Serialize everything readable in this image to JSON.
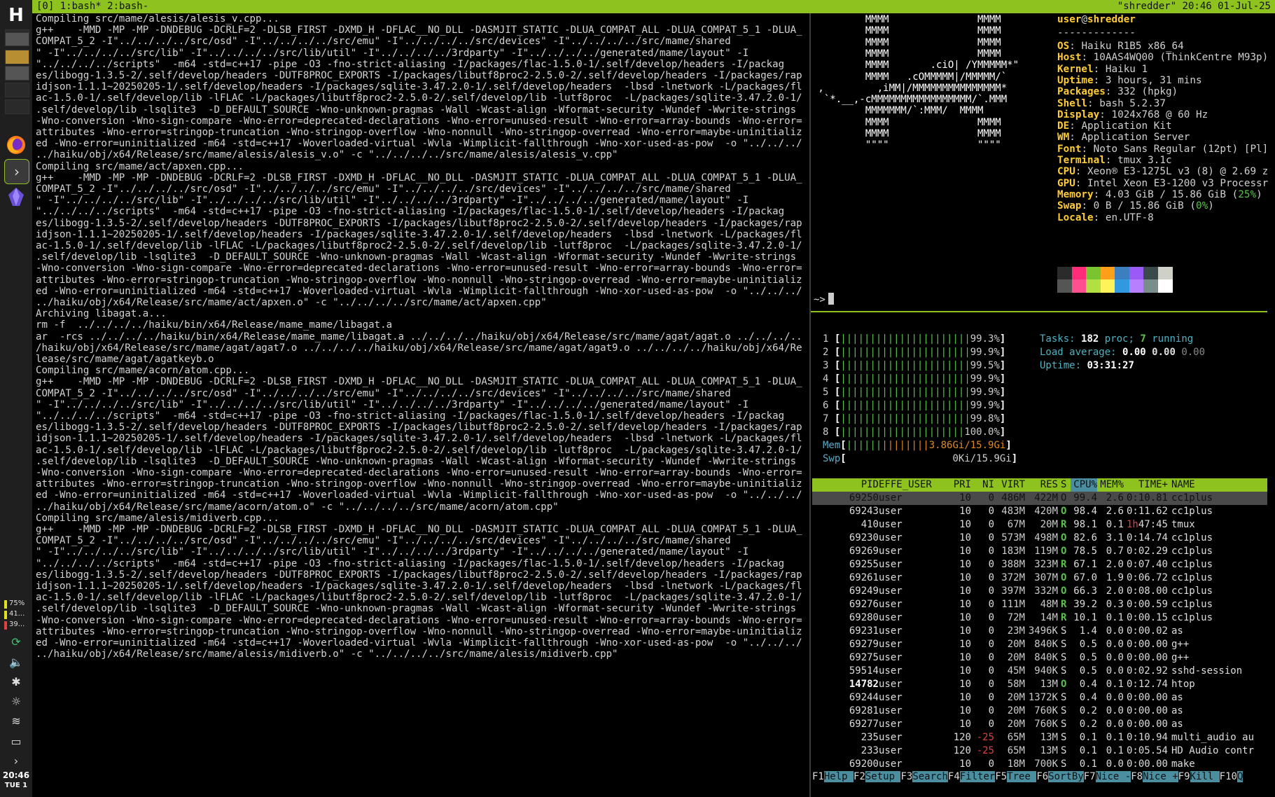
{
  "tmux": {
    "left": "[0] 1:bash* 2:bash-",
    "right": "\"shredder\" 20:46 01-Jul-25"
  },
  "dock": {
    "logo": "H",
    "meters": [
      {
        "label": "75%",
        "color": "#e0e020"
      },
      {
        "label": "41...",
        "color": "#e0e020"
      },
      {
        "label": "39...",
        "color": "#e04040"
      }
    ],
    "clock_time": "20:46",
    "clock_day": "TUE 1"
  },
  "compile_log": [
    "Compiling src/mame/alesis/alesis_v.cpp...",
    "g++    -MMD -MP -MP -DNDEBUG -DCRLF=2 -DLSB_FIRST -DXMD_H -DFLAC__NO_DLL -DASMJIT_STATIC -DLUA_COMPAT_ALL -DLUA_COMPAT_5_1 -DLUA_",
    "COMPAT_5_2 -I\"../../../../src/osd\" -I\"../../../../src/emu\" -I\"../../../../src/devices\" -I\"../../../../src/mame/shared",
    "\" -I\"../../../../src/lib\" -I\"../../../../src/lib/util\" -I\"../../../../3rdparty\" -I\"../../../../generated/mame/layout\" -I",
    "\"../../../../scripts\"  -m64 -std=c++17 -pipe -O3 -fno-strict-aliasing -I/packages/flac-1.5.0-1/.self/develop/headers -I/packag",
    "es/libogg-1.3.5-2/.self/develop/headers -DUTF8PROC_EXPORTS -I/packages/libutf8proc2-2.5.0-2/.self/develop/headers -I/packages/rap",
    "idjson-1.1.1~20250205-1/.self/develop/headers -I/packages/sqlite-3.47.2.0-1/.self/develop/headers  -lbsd -lnetwork -L/packages/fl",
    "ac-1.5.0-1/.self/develop/lib -lFLAC -L/packages/libutf8proc2-2.5.0-2/.self/develop/lib -lutf8proc  -L/packages/sqlite-3.47.2.0-1/",
    ".self/develop/lib -lsqlite3  -D_DEFAULT_SOURCE -Wno-unknown-pragmas -Wall -Wcast-align -Wformat-security -Wundef -Wwrite-strings",
    "-Wno-conversion -Wno-sign-compare -Wno-error=deprecated-declarations -Wno-error=unused-result -Wno-error=array-bounds -Wno-error=",
    "attributes -Wno-error=stringop-truncation -Wno-stringop-overflow -Wno-nonnull -Wno-stringop-overread -Wno-error=maybe-uninitializ",
    "ed -Wno-error=uninitialized -m64 -std=c++17 -Woverloaded-virtual -Wvla -Wimplicit-fallthrough -Wno-xor-used-as-pow  -o \"../../../",
    "../haiku/obj/x64/Release/src/mame/alesis/alesis_v.o\" -c \"../../../../src/mame/alesis/alesis_v.cpp\"",
    "Compiling src/mame/act/apxen.cpp...",
    "g++    -MMD -MP -MP -DNDEBUG -DCRLF=2 -DLSB_FIRST -DXMD_H -DFLAC__NO_DLL -DASMJIT_STATIC -DLUA_COMPAT_ALL -DLUA_COMPAT_5_1 -DLUA_",
    "COMPAT_5_2 -I\"../../../../src/osd\" -I\"../../../../src/emu\" -I\"../../../../src/devices\" -I\"../../../../src/mame/shared",
    "\" -I\"../../../../src/lib\" -I\"../../../../src/lib/util\" -I\"../../../../3rdparty\" -I\"../../../../generated/mame/layout\" -I",
    "\"../../../../scripts\"  -m64 -std=c++17 -pipe -O3 -fno-strict-aliasing -I/packages/flac-1.5.0-1/.self/develop/headers -I/packag",
    "es/libogg-1.3.5-2/.self/develop/headers -DUTF8PROC_EXPORTS -I/packages/libutf8proc2-2.5.0-2/.self/develop/headers -I/packages/rap",
    "idjson-1.1.1~20250205-1/.self/develop/headers -I/packages/sqlite-3.47.2.0-1/.self/develop/headers  -lbsd -lnetwork -L/packages/fl",
    "ac-1.5.0-1/.self/develop/lib -lFLAC -L/packages/libutf8proc2-2.5.0-2/.self/develop/lib -lutf8proc  -L/packages/sqlite-3.47.2.0-1/",
    ".self/develop/lib -lsqlite3  -D_DEFAULT_SOURCE -Wno-unknown-pragmas -Wall -Wcast-align -Wformat-security -Wundef -Wwrite-strings",
    "-Wno-conversion -Wno-sign-compare -Wno-error=deprecated-declarations -Wno-error=unused-result -Wno-error=array-bounds -Wno-error=",
    "attributes -Wno-error=stringop-truncation -Wno-stringop-overflow -Wno-nonnull -Wno-stringop-overread -Wno-error=maybe-uninitializ",
    "ed -Wno-error=uninitialized -m64 -std=c++17 -Woverloaded-virtual -Wvla -Wimplicit-fallthrough -Wno-xor-used-as-pow  -o \"../../../",
    "../haiku/obj/x64/Release/src/mame/act/apxen.o\" -c \"../../../../src/mame/act/apxen.cpp\"",
    "Archiving libagat.a...",
    "rm -f  ../../../../haiku/bin/x64/Release/mame_mame/libagat.a",
    "ar  -rcs ../../../../haiku/bin/x64/Release/mame_mame/libagat.a ../../../../haiku/obj/x64/Release/src/mame/agat/agat.o ../../../..",
    "/haiku/obj/x64/Release/src/mame/agat/agat7.o ../../../../haiku/obj/x64/Release/src/mame/agat/agat9.o ../../../../haiku/obj/x64/Re",
    "lease/src/mame/agat/agatkeyb.o",
    "Compiling src/mame/acorn/atom.cpp...",
    "g++    -MMD -MP -MP -DNDEBUG -DCRLF=2 -DLSB_FIRST -DXMD_H -DFLAC__NO_DLL -DASMJIT_STATIC -DLUA_COMPAT_ALL -DLUA_COMPAT_5_1 -DLUA_",
    "COMPAT_5_2 -I\"../../../../src/osd\" -I\"../../../../src/emu\" -I\"../../../../src/devices\" -I\"../../../../src/mame/shared",
    "\" -I\"../../../../src/lib\" -I\"../../../../src/lib/util\" -I\"../../../../3rdparty\" -I\"../../../../generated/mame/layout\" -I",
    "\"../../../../scripts\"  -m64 -std=c++17 -pipe -O3 -fno-strict-aliasing -I/packages/flac-1.5.0-1/.self/develop/headers -I/packag",
    "es/libogg-1.3.5-2/.self/develop/headers -DUTF8PROC_EXPORTS -I/packages/libutf8proc2-2.5.0-2/.self/develop/headers -I/packages/rap",
    "idjson-1.1.1~20250205-1/.self/develop/headers -I/packages/sqlite-3.47.2.0-1/.self/develop/headers  -lbsd -lnetwork -L/packages/fl",
    "ac-1.5.0-1/.self/develop/lib -lFLAC -L/packages/libutf8proc2-2.5.0-2/.self/develop/lib -lutf8proc  -L/packages/sqlite-3.47.2.0-1/",
    ".self/develop/lib -lsqlite3  -D_DEFAULT_SOURCE -Wno-unknown-pragmas -Wall -Wcast-align -Wformat-security -Wundef -Wwrite-strings",
    "-Wno-conversion -Wno-sign-compare -Wno-error=deprecated-declarations -Wno-error=unused-result -Wno-error=array-bounds -Wno-error=",
    "attributes -Wno-error=stringop-truncation -Wno-stringop-overflow -Wno-nonnull -Wno-stringop-overread -Wno-error=maybe-uninitializ",
    "ed -Wno-error=uninitialized -m64 -std=c++17 -Woverloaded-virtual -Wvla -Wimplicit-fallthrough -Wno-xor-used-as-pow  -o \"../../../",
    "../haiku/obj/x64/Release/src/mame/acorn/atom.o\" -c \"../../../../src/mame/acorn/atom.cpp\"",
    "Compiling src/mame/alesis/midiverb.cpp...",
    "g++    -MMD -MP -MP -DNDEBUG -DCRLF=2 -DLSB_FIRST -DXMD_H -DFLAC__NO_DLL -DASMJIT_STATIC -DLUA_COMPAT_ALL -DLUA_COMPAT_5_1 -DLUA_",
    "COMPAT_5_2 -I\"../../../../src/osd\" -I\"../../../../src/emu\" -I\"../../../../src/devices\" -I\"../../../../src/mame/shared",
    "\" -I\"../../../../src/lib\" -I\"../../../../src/lib/util\" -I\"../../../../3rdparty\" -I\"../../../../generated/mame/layout\" -I",
    "\"../../../../scripts\"  -m64 -std=c++17 -pipe -O3 -fno-strict-aliasing -I/packages/flac-1.5.0-1/.self/develop/headers -I/packag",
    "es/libogg-1.3.5-2/.self/develop/headers -DUTF8PROC_EXPORTS -I/packages/libutf8proc2-2.5.0-2/.self/develop/headers -I/packages/rap",
    "idjson-1.1.1~20250205-1/.self/develop/headers -I/packages/sqlite-3.47.2.0-1/.self/develop/headers  -lbsd -lnetwork -L/packages/fl",
    "ac-1.5.0-1/.self/develop/lib -lFLAC -L/packages/libutf8proc2-2.5.0-2/.self/develop/lib -lutf8proc  -L/packages/sqlite-3.47.2.0-1/",
    ".self/develop/lib -lsqlite3  -D_DEFAULT_SOURCE -Wno-unknown-pragmas -Wall -Wcast-align -Wformat-security -Wundef -Wwrite-strings",
    "-Wno-conversion -Wno-sign-compare -Wno-error=deprecated-declarations -Wno-error=unused-result -Wno-error=array-bounds -Wno-error=",
    "attributes -Wno-error=stringop-truncation -Wno-stringop-overflow -Wno-nonnull -Wno-stringop-overread -Wno-error=maybe-uninitializ",
    "ed -Wno-error=uninitialized -m64 -std=c++17 -Woverloaded-virtual -Wvla -Wimplicit-fallthrough -Wno-xor-used-as-pow  -o \"../../../",
    "../haiku/obj/x64/Release/src/mame/alesis/midiverb.o\" -c \"../../../../src/mame/alesis/midiverb.cpp\""
  ],
  "neofetch": {
    "art": [
      "         MMMM               MMMM",
      "         MMMM               MMMM",
      "         MMMM               MMMM",
      "         MMMM               MMMM",
      "         MMMM       .ciO| /YMMMMM*\"",
      "         MMMM   .cOMMMMM|/MMMMM/`",
      " ,         ,iMM|/MMMMMMMMMMMMMMM*",
      "  `*.__,-cMMMMMMMMMMMMMMMMM/`.MMM",
      "         MMMMMMM/`:MMM/  MMMM",
      "         MMMM               MMMM",
      "         MMMM               MMMM",
      "         \"\"\"\"               \"\"\"\""
    ],
    "title_user": "user",
    "title_at": "@",
    "title_host": "shredder",
    "separator": "-------------",
    "fields": [
      {
        "k": "OS",
        "v": "Haiku R1B5 x86_64"
      },
      {
        "k": "Host",
        "v": "10AAS4WQ00 (ThinkCentre M93p)"
      },
      {
        "k": "Kernel",
        "v": "Haiku 1"
      },
      {
        "k": "Uptime",
        "v": "3 hours, 31 mins"
      },
      {
        "k": "Packages",
        "v": "332 (hpkg)"
      },
      {
        "k": "Shell",
        "v": "bash 5.2.37"
      },
      {
        "k": "Display",
        "v": "1024x768 @ 60 Hz"
      },
      {
        "k": "DE",
        "v": "Application Kit"
      },
      {
        "k": "WM",
        "v": "Application Server"
      },
      {
        "k": "Font",
        "v": "Noto Sans Regular (12pt) [Pl]"
      },
      {
        "k": "Terminal",
        "v": "tmux 3.1c"
      },
      {
        "k": "CPU",
        "v": "Xeon® E3-1275L v3 (8) @ 2.69 z"
      },
      {
        "k": "GPU",
        "v": "Intel Xeon E3-1200 v3 Processr"
      },
      {
        "k": "Memory",
        "v": "4.03 GiB / 15.86 GiB (",
        "pct": "25%",
        "tail": ")"
      },
      {
        "k": "Swap",
        "v": "0 B / 15.86 GiB (",
        "pct": "0%",
        "tail": ")"
      },
      {
        "k": "Locale",
        "v": "en.UTF-8"
      }
    ],
    "palette_top": [
      "#2b2b2b",
      "#ff2d79",
      "#7ac52f",
      "#ff9f1a",
      "#3c7fbf",
      "#9b59f5",
      "#3a4a4a",
      "#cfd0c8"
    ],
    "palette_bottom": [
      "#555555",
      "#ff4f8f",
      "#b2e042",
      "#fff25a",
      "#3199e0",
      "#b77ffe",
      "#7a8d8d",
      "#ffffff"
    ],
    "prompt": "~>"
  },
  "htop": {
    "cpus": [
      {
        "n": "1",
        "pct": "99.3%"
      },
      {
        "n": "2",
        "pct": "99.9%"
      },
      {
        "n": "3",
        "pct": "99.5%"
      },
      {
        "n": "4",
        "pct": "99.9%"
      },
      {
        "n": "5",
        "pct": "99.9%"
      },
      {
        "n": "6",
        "pct": "99.9%"
      },
      {
        "n": "7",
        "pct": "99.8%"
      },
      {
        "n": "8",
        "pct": "100.0%"
      }
    ],
    "mem_label": "Mem",
    "mem_value": "3.86Gi/15.9Gi",
    "swp_label": "Swp",
    "swp_value": "0Ki/15.9Gi",
    "tasks_label": "Tasks:",
    "tasks_count": "182",
    "tasks_mid": "proc;",
    "tasks_running": "7",
    "tasks_tail": "running",
    "load_label": "Load average:",
    "load1": "0.00",
    "load5": "0.00",
    "load15": "0.00",
    "uptime_label": "Uptime:",
    "uptime": "03:31:27",
    "columns": [
      "PID",
      "EFFE_USER",
      "PRI",
      "NI",
      "VIRT",
      "RES",
      "S",
      "CPU%",
      "MEM%",
      "TIME+",
      "NAME"
    ],
    "processes": [
      {
        "pid": "69250",
        "user": "user",
        "pri": "10",
        "ni": "0",
        "virt": "486M",
        "res": "422M",
        "s": "O",
        "cpu": "99.4",
        "mem": "2.6",
        "time": "0:10.81",
        "name": "cc1plus"
      },
      {
        "pid": "69243",
        "user": "user",
        "pri": "10",
        "ni": "0",
        "virt": "483M",
        "res": "420M",
        "s": "O",
        "cpu": "98.4",
        "mem": "2.6",
        "time": "0:11.62",
        "name": "cc1plus"
      },
      {
        "pid": "410",
        "user": "user",
        "pri": "10",
        "ni": "0",
        "virt": "67M",
        "res": "20M",
        "s": "R",
        "cpu": "98.1",
        "mem": "0.1",
        "time_h": "1h",
        "time": "47:45",
        "name": "tmux"
      },
      {
        "pid": "69230",
        "user": "user",
        "pri": "10",
        "ni": "0",
        "virt": "573M",
        "res": "498M",
        "s": "O",
        "cpu": "82.6",
        "mem": "3.1",
        "time": "0:14.74",
        "name": "cc1plus"
      },
      {
        "pid": "69269",
        "user": "user",
        "pri": "10",
        "ni": "0",
        "virt": "183M",
        "res": "119M",
        "s": "O",
        "cpu": "78.5",
        "mem": "0.7",
        "time": "0:02.29",
        "name": "cc1plus"
      },
      {
        "pid": "69255",
        "user": "user",
        "pri": "10",
        "ni": "0",
        "virt": "388M",
        "res": "323M",
        "s": "R",
        "cpu": "67.1",
        "mem": "2.0",
        "time": "0:07.40",
        "name": "cc1plus"
      },
      {
        "pid": "69261",
        "user": "user",
        "pri": "10",
        "ni": "0",
        "virt": "372M",
        "res": "307M",
        "s": "O",
        "cpu": "67.0",
        "mem": "1.9",
        "time": "0:06.72",
        "name": "cc1plus"
      },
      {
        "pid": "69249",
        "user": "user",
        "pri": "10",
        "ni": "0",
        "virt": "397M",
        "res": "332M",
        "s": "O",
        "cpu": "66.3",
        "mem": "2.0",
        "time": "0:08.00",
        "name": "cc1plus"
      },
      {
        "pid": "69276",
        "user": "user",
        "pri": "10",
        "ni": "0",
        "virt": "111M",
        "res": "48M",
        "s": "R",
        "cpu": "39.2",
        "mem": "0.3",
        "time": "0:00.59",
        "name": "cc1plus"
      },
      {
        "pid": "69280",
        "user": "user",
        "pri": "10",
        "ni": "0",
        "virt": "72M",
        "res": "14M",
        "s": "R",
        "cpu": "10.1",
        "mem": "0.1",
        "time": "0:00.15",
        "name": "cc1plus"
      },
      {
        "pid": "69231",
        "user": "user",
        "pri": "10",
        "ni": "0",
        "virt": "23M",
        "res": "3496K",
        "s": "S",
        "cpu": "1.4",
        "mem": "0.0",
        "time": "0:00.02",
        "name": "as"
      },
      {
        "pid": "69279",
        "user": "user",
        "pri": "10",
        "ni": "0",
        "virt": "20M",
        "res": "840K",
        "s": "S",
        "cpu": "0.5",
        "mem": "0.0",
        "time": "0:00.00",
        "name": "g++"
      },
      {
        "pid": "69275",
        "user": "user",
        "pri": "10",
        "ni": "0",
        "virt": "20M",
        "res": "840K",
        "s": "S",
        "cpu": "0.5",
        "mem": "0.0",
        "time": "0:00.00",
        "name": "g++"
      },
      {
        "pid": "59514",
        "user": "user",
        "pri": "10",
        "ni": "0",
        "virt": "45M",
        "res": "940K",
        "s": "S",
        "cpu": "0.5",
        "mem": "0.0",
        "time": "0:02.92",
        "name": "sshd-session"
      },
      {
        "pid": "14782",
        "user": "user",
        "pri": "10",
        "ni": "0",
        "virt": "58M",
        "res": "13M",
        "s": "O",
        "cpu": "0.4",
        "mem": "0.1",
        "time": "0:12.74",
        "name": "htop"
      },
      {
        "pid": "69244",
        "user": "user",
        "pri": "10",
        "ni": "0",
        "virt": "20M",
        "res": "1372K",
        "s": "S",
        "cpu": "0.4",
        "mem": "0.0",
        "time": "0:00.00",
        "name": "as"
      },
      {
        "pid": "69281",
        "user": "user",
        "pri": "10",
        "ni": "0",
        "virt": "20M",
        "res": "760K",
        "s": "S",
        "cpu": "0.2",
        "mem": "0.0",
        "time": "0:00.00",
        "name": "as"
      },
      {
        "pid": "69277",
        "user": "user",
        "pri": "10",
        "ni": "0",
        "virt": "20M",
        "res": "760K",
        "s": "S",
        "cpu": "0.2",
        "mem": "0.0",
        "time": "0:00.00",
        "name": "as"
      },
      {
        "pid": "235",
        "user": "user",
        "pri": "120",
        "ni": "-25",
        "virt": "65M",
        "res": "13M",
        "s": "S",
        "cpu": "0.1",
        "mem": "0.1",
        "time": "0:10.94",
        "name": "multi_audio au"
      },
      {
        "pid": "233",
        "user": "user",
        "pri": "120",
        "ni": "-25",
        "virt": "65M",
        "res": "13M",
        "s": "S",
        "cpu": "0.1",
        "mem": "0.1",
        "time": "0:05.54",
        "name": "HD Audio contr"
      },
      {
        "pid": "69200",
        "user": "user",
        "pri": "10",
        "ni": "0",
        "virt": "18M",
        "res": "700K",
        "s": "S",
        "cpu": "0.1",
        "mem": "0.0",
        "time": "0:00.00",
        "name": "make"
      }
    ],
    "fkeys": [
      {
        "k": "F1",
        "l": "Help  "
      },
      {
        "k": "F2",
        "l": "Setup "
      },
      {
        "k": "F3",
        "l": "Search"
      },
      {
        "k": "F4",
        "l": "Filter"
      },
      {
        "k": "F5",
        "l": "Tree  "
      },
      {
        "k": "F6",
        "l": "SortBy"
      },
      {
        "k": "F7",
        "l": "Nice -"
      },
      {
        "k": "F8",
        "l": "Nice +"
      },
      {
        "k": "F9",
        "l": "Kill  "
      },
      {
        "k": "F10",
        "l": "Q"
      }
    ]
  }
}
